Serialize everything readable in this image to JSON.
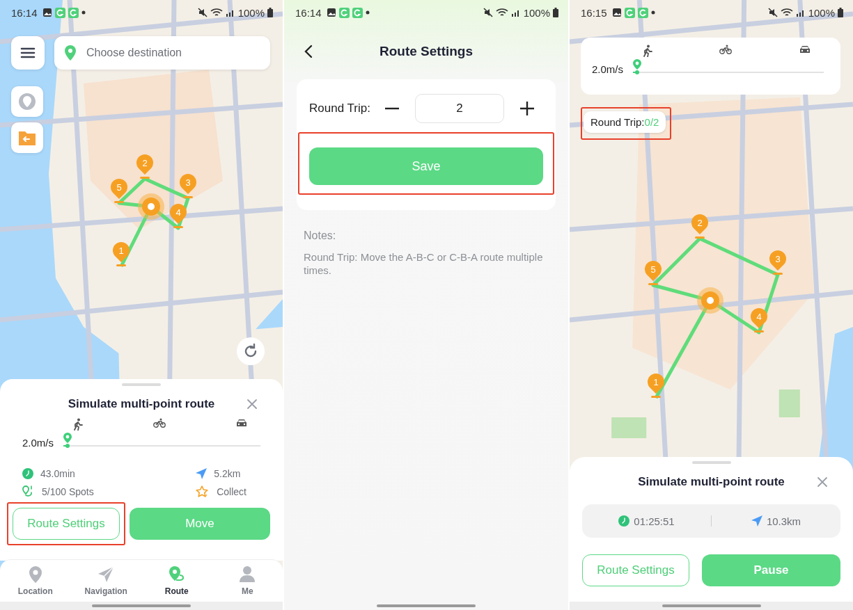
{
  "screen_1": {
    "status_bar": {
      "time": "16:14",
      "battery": "100%"
    },
    "search": {
      "placeholder": "Choose destination"
    },
    "pins": [
      {
        "label": "1"
      },
      {
        "label": "2"
      },
      {
        "label": "3"
      },
      {
        "label": "4"
      },
      {
        "label": "5"
      }
    ],
    "sheet": {
      "title": "Simulate multi-point route",
      "speed": "2.0m/s",
      "speed_level": {
        "level": 0.02
      },
      "stats": [
        {
          "kind": "time",
          "text": "43.0min"
        },
        {
          "kind": "distance",
          "text": "5.2km"
        },
        {
          "kind": "spots",
          "text": "5/100 Spots"
        },
        {
          "kind": "collect",
          "text": "Collect"
        }
      ],
      "buttons": [
        {
          "kind": "outline",
          "label": "Route Settings",
          "highlighted": true
        },
        {
          "kind": "filled",
          "label": "Move",
          "highlighted": false
        }
      ]
    },
    "tab_bar": [
      {
        "kind": "location",
        "label": "Location",
        "selected": false
      },
      {
        "kind": "navigation",
        "label": "Navigation",
        "selected": false
      },
      {
        "kind": "route",
        "label": "Route",
        "selected": true
      },
      {
        "kind": "me",
        "label": "Me",
        "selected": false
      }
    ]
  },
  "screen_2": {
    "status_bar": {
      "time": "16:14",
      "battery": "100%"
    },
    "title": "Route Settings",
    "round_trip": {
      "label": "Round Trip:",
      "value": "2"
    },
    "save_button": {
      "label": "Save",
      "highlighted": true
    },
    "notes": {
      "heading": "Notes:",
      "text": "Round Trip: Move the A-B-C or C-B-A route multiple times."
    }
  },
  "screen_3": {
    "status_bar": {
      "time": "16:15",
      "battery": "100%"
    },
    "speed": "2.0m/s",
    "speed_level": {
      "level": 0.02
    },
    "round_trip_chip": {
      "label": "Round Trip:",
      "count": "0/2",
      "highlighted": true
    },
    "pins": [
      {
        "label": "1"
      },
      {
        "label": "2"
      },
      {
        "label": "3"
      },
      {
        "label": "4"
      },
      {
        "label": "5"
      }
    ],
    "sheet": {
      "title": "Simulate multi-point route",
      "elapsed": "01:25:51",
      "distance": "10.3km",
      "buttons": [
        {
          "kind": "outline",
          "label": "Route Settings",
          "highlighted": false
        },
        {
          "kind": "filled",
          "label": "Pause",
          "highlighted": false
        }
      ]
    }
  }
}
